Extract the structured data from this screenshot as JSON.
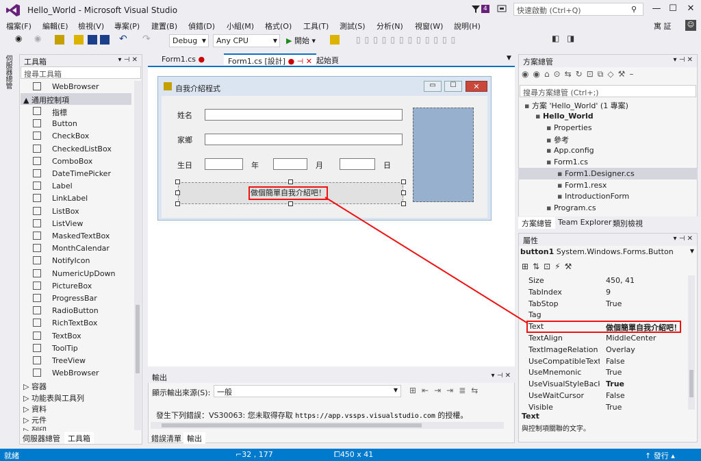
{
  "window": {
    "title": "Hello_World - Microsoft Visual Studio",
    "notification_count": "4",
    "quick_launch_placeholder": "快速啟動 (Ctrl+Q)",
    "minimize": "—",
    "maximize": "☐",
    "close": "✕"
  },
  "menu": [
    "檔案(F)",
    "編輯(E)",
    "檢視(V)",
    "專案(P)",
    "建置(B)",
    "偵錯(D)",
    "小組(M)",
    "格式(O)",
    "工具(T)",
    "測試(S)",
    "分析(N)",
    "視窗(W)",
    "說明(H)"
  ],
  "user": {
    "name": "寓 証",
    "avatar": "☺"
  },
  "toolbar": {
    "config": "Debug",
    "platform": "Any CPU",
    "start_label": "開始"
  },
  "left_rail": {
    "server_explorer": "伺服器總管"
  },
  "toolbox": {
    "title": "工具箱",
    "search_placeholder": "搜尋工具箱",
    "top_item": "WebBrowser",
    "group_common": "▲ 通用控制項",
    "items": [
      "指標",
      "Button",
      "CheckBox",
      "CheckedListBox",
      "ComboBox",
      "DateTimePicker",
      "Label",
      "LinkLabel",
      "ListBox",
      "ListView",
      "MaskedTextBox",
      "MonthCalendar",
      "NotifyIcon",
      "NumericUpDown",
      "PictureBox",
      "ProgressBar",
      "RadioButton",
      "RichTextBox",
      "TextBox",
      "ToolTip",
      "TreeView",
      "WebBrowser"
    ],
    "groups": [
      "▷ 容器",
      "▷ 功能表與工具列",
      "▷ 資料",
      "▷ 元件",
      "▷ 列印"
    ],
    "bottom_tabs": [
      "伺服器總管",
      "工具箱"
    ]
  },
  "doc_tabs": [
    {
      "label": "Form1.cs",
      "mark": "●"
    },
    {
      "label": "Form1.cs [設計]",
      "mark": "● ⊣ ✕"
    },
    {
      "label": "起始頁",
      "mark": ""
    }
  ],
  "form": {
    "title": "自我介紹程式",
    "labels": {
      "name": "姓名",
      "hometown": "家鄉",
      "birthday": "生日",
      "year": "年",
      "month": "月",
      "day": "日"
    },
    "button_text": "做個簡單自我介紹吧！"
  },
  "output": {
    "title": "輸出",
    "source_label": "顯示輸出來源(S):",
    "source_value": "一般",
    "message": "發生下列錯誤：VS30063: 您未取得存取",
    "url": "https://app.vssps.visualstudio.com",
    "message_tail": "的授權。",
    "bottom_tabs": [
      "錯誤清單",
      "輸出"
    ]
  },
  "solution": {
    "title": "方案總管",
    "search_placeholder": "搜尋方案總管 (Ctrl+;)",
    "items": [
      {
        "label": "方案 'Hello_World' (1 專案)",
        "indent": 0
      },
      {
        "label": "Hello_World",
        "indent": 1
      },
      {
        "label": "Properties",
        "indent": 2
      },
      {
        "label": "參考",
        "indent": 2
      },
      {
        "label": "App.config",
        "indent": 2
      },
      {
        "label": "Form1.cs",
        "indent": 2
      },
      {
        "label": "Form1.Designer.cs",
        "indent": 3
      },
      {
        "label": "Form1.resx",
        "indent": 3
      },
      {
        "label": "IntroductionForm",
        "indent": 3
      },
      {
        "label": "Program.cs",
        "indent": 2
      }
    ],
    "tabs": [
      "方案總管",
      "Team Explorer",
      "類別檢視"
    ]
  },
  "properties": {
    "title": "屬性",
    "object": "button1",
    "object_type": "System.Windows.Forms.Button",
    "rows": [
      {
        "name": "Size",
        "value": "450, 41"
      },
      {
        "name": "TabIndex",
        "value": "9"
      },
      {
        "name": "TabStop",
        "value": "True"
      },
      {
        "name": "Tag",
        "value": ""
      },
      {
        "name": "Text",
        "value": "做個簡單自我介紹吧！"
      },
      {
        "name": "TextAlign",
        "value": "MiddleCenter"
      },
      {
        "name": "TextImageRelation",
        "value": "Overlay"
      },
      {
        "name": "UseCompatibleTextRe",
        "value": "False"
      },
      {
        "name": "UseMnemonic",
        "value": "True"
      },
      {
        "name": "UseVisualStyleBackCc",
        "value": "True"
      },
      {
        "name": "UseWaitCursor",
        "value": "False"
      },
      {
        "name": "Visible",
        "value": "True"
      }
    ],
    "desc_title": "Text",
    "desc": "與控制項關聯的文字。"
  },
  "status": {
    "ready": "就緒",
    "position": "32 , 177",
    "size": "450 x 41",
    "publish": "發行"
  },
  "colors": {
    "accent": "#007acc",
    "highlight_red": "#e11111"
  }
}
